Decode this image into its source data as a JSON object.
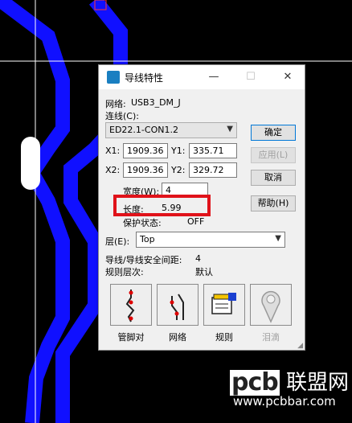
{
  "dialog": {
    "title": "导线特性",
    "minimize": "—",
    "maximize": "☐",
    "close": "✕",
    "net_label": "网络:",
    "net_value": "USB3_DM_J",
    "connection_label": "连线(C):",
    "connection_value": "ED22.1-CON1.2",
    "x1_label": "X1:",
    "x1_value": "1909.36",
    "y1_label": "Y1:",
    "y1_value": "335.71",
    "x2_label": "X2:",
    "x2_value": "1909.36",
    "y2_label": "Y2:",
    "y2_value": "329.72",
    "width_label": "宽度(W):",
    "width_value": "4",
    "length_label": "长度:",
    "length_value": "5.99",
    "protect_label": "保护状态:",
    "protect_value": "OFF",
    "layer_label": "层(E):",
    "layer_value": "Top",
    "clearance_label": "导线/导线安全间距:",
    "clearance_value": "4",
    "rule_level_label": "规则层次:",
    "rule_level_value": "默认",
    "buttons": {
      "ok": "确定",
      "apply": "应用(L)",
      "cancel": "取消",
      "help": "帮助(H)"
    },
    "big_buttons": [
      "管脚对",
      "网络",
      "规则",
      "泪滴"
    ]
  },
  "colors": {
    "trace": "#1010ff",
    "highlight": "#e0121a",
    "background": "#000000"
  },
  "watermark": {
    "brand": "pcb",
    "cn": "联盟网",
    "url": "www.pcbbar.com"
  }
}
